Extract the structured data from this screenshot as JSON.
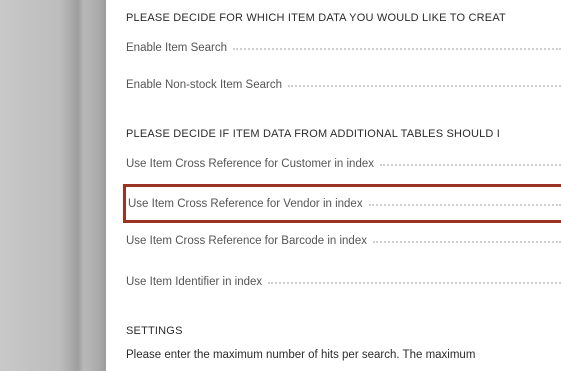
{
  "section1": {
    "header": "PLEASE DECIDE FOR WHICH ITEM DATA YOU WOULD LIKE TO CREAT",
    "fields": [
      {
        "label": "Enable Item Search"
      },
      {
        "label": "Enable Non-stock Item Search"
      }
    ]
  },
  "section2": {
    "header": "PLEASE DECIDE IF ITEM DATA FROM ADDITIONAL TABLES SHOULD I",
    "fields": [
      {
        "label": "Use Item Cross Reference for Customer in index"
      },
      {
        "label": "Use Item Cross Reference for Vendor in index",
        "highlighted": true
      },
      {
        "label": "Use Item Cross Reference for Barcode in index"
      },
      {
        "label": "Use Item Identifier in index"
      }
    ]
  },
  "settings": {
    "header": "SETTINGS",
    "help_text": "Please enter the maximum number of hits per search. The maximum"
  },
  "colors": {
    "highlight_border": "#9b3324",
    "dotted_leader": "#cfcfcf"
  }
}
